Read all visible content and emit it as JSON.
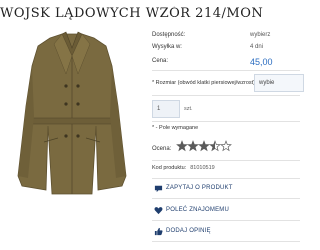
{
  "product": {
    "title": "WOJSK LĄDOWYCH WZÓR 214/MON",
    "image_icon": "coat-photo"
  },
  "details": {
    "availability_label": "Dostępność:",
    "availability_value": "wybierz",
    "shipping_label": "Wysyłka w:",
    "shipping_value": "4 dni",
    "price_label": "Cena:",
    "price_value": "45,00"
  },
  "options": {
    "size_label": "* Rozmiar (obwód klatki piersiowej/wzrost):",
    "size_value": "wybie"
  },
  "quantity": {
    "value": "1",
    "unit": "szt."
  },
  "required_note": "* - Pole wymagane",
  "rating": {
    "label": "Ocena:",
    "value": 3.5,
    "max": 5
  },
  "product_code": {
    "label": "Kod produktu:",
    "value": "81010519"
  },
  "actions": {
    "ask": "ZAPYTAJ O PRODUKT",
    "recommend": "POLEĆ ZNAJOMEMU",
    "review": "DODAJ OPINIĘ"
  },
  "colors": {
    "accent": "#2a6cc0",
    "action_text": "#1f3e6e",
    "coat": "#7a6a40"
  }
}
